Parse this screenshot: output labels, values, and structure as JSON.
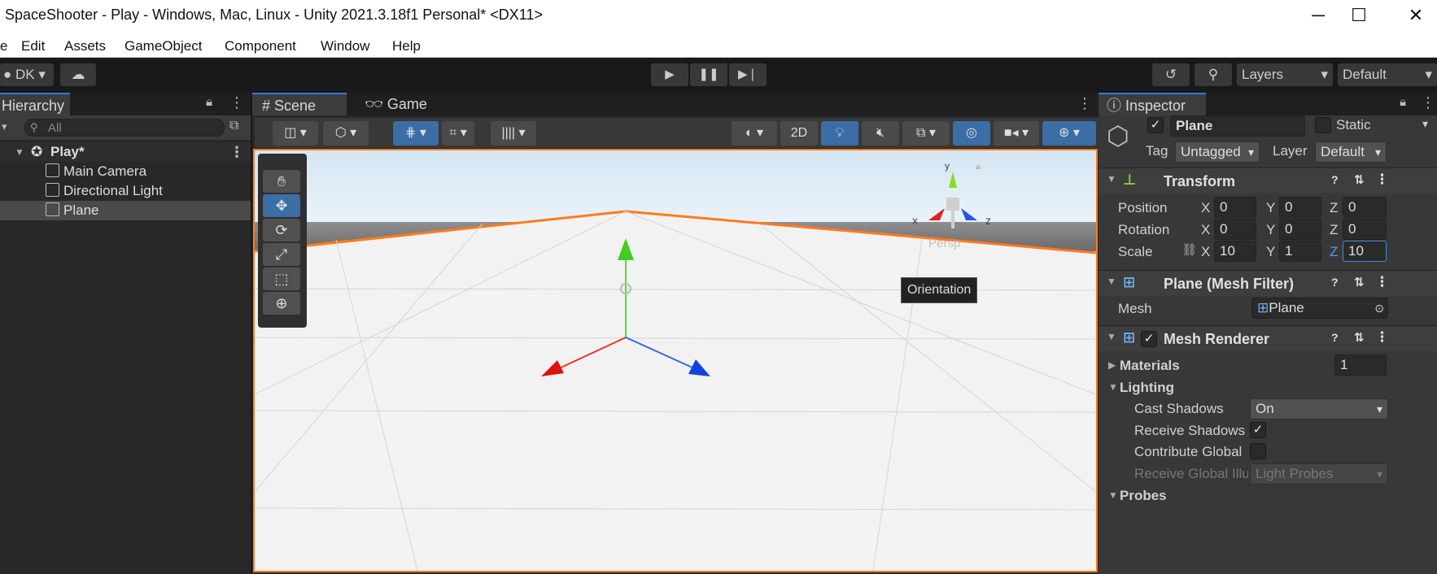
{
  "window": {
    "title": "SpaceShooter - Play - Windows, Mac, Linux - Unity 2021.3.18f1 Personal* <DX11>",
    "min": "─",
    "max": "☐",
    "close": "✕"
  },
  "menu": [
    "e",
    "Edit",
    "Assets",
    "GameObject",
    "Component",
    "Window",
    "Help"
  ],
  "toolbar": {
    "account": "DK",
    "layers": "Layers",
    "layout": "Default"
  },
  "hierarchy": {
    "tab": "Hierarchy",
    "search_placeholder": "All",
    "scene": "Play*",
    "items": [
      "Main Camera",
      "Directional Light",
      "Plane"
    ]
  },
  "scene": {
    "tabs": [
      "Scene",
      "Game"
    ],
    "mode_2d": "2D",
    "persp": "Persp",
    "tooltip": "Orientation",
    "axis_x": "x",
    "axis_y": "y",
    "axis_z": "z"
  },
  "inspector": {
    "tab": "Inspector",
    "name": "Plane",
    "static": "Static",
    "tag_label": "Tag",
    "tag": "Untagged",
    "layer_label": "Layer",
    "layer": "Default",
    "transform": {
      "title": "Transform",
      "position": "Position",
      "rotation": "Rotation",
      "scale": "Scale",
      "pos": [
        "0",
        "0",
        "0"
      ],
      "rot": [
        "0",
        "0",
        "0"
      ],
      "scl": [
        "10",
        "1",
        "10"
      ],
      "x": "X",
      "y": "Y",
      "z": "Z"
    },
    "mesh_filter": {
      "title": "Plane (Mesh Filter)",
      "mesh_label": "Mesh",
      "mesh": "Plane"
    },
    "mesh_renderer": {
      "title": "Mesh Renderer",
      "materials": "Materials",
      "materials_count": "1",
      "lighting": "Lighting",
      "cast_shadows": "Cast Shadows",
      "cast_shadows_value": "On",
      "receive_shadows": "Receive Shadows",
      "contribute_global": "Contribute Global",
      "receive_global": "Receive Global Illu",
      "receive_global_value": "Light Probes",
      "probes": "Probes"
    }
  }
}
